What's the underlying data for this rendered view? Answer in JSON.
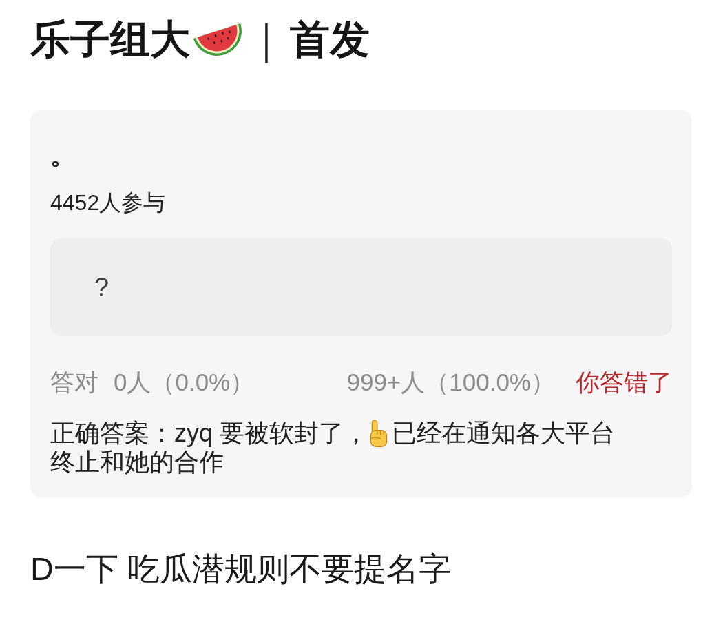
{
  "title": {
    "text": "乐子组大",
    "separator": "｜",
    "subtitle": "首发"
  },
  "quiz": {
    "question": "。",
    "participants": "4452人参与",
    "options": [
      {
        "label": "?"
      }
    ],
    "stats": {
      "correct_label": "答对",
      "correct_count": "0人（0.0%）",
      "wrong_count": "999+人（100.0%）"
    },
    "result": {
      "text": "你答错了",
      "correct": false
    },
    "answer": {
      "text_before_icon": "正确答案：zyq 要被软封了，",
      "text_after_icon": "已经在通知各大平台",
      "continuation": "终止和她的合作"
    }
  },
  "footer": "D一下 吃瓜潜规则不要提名字"
}
